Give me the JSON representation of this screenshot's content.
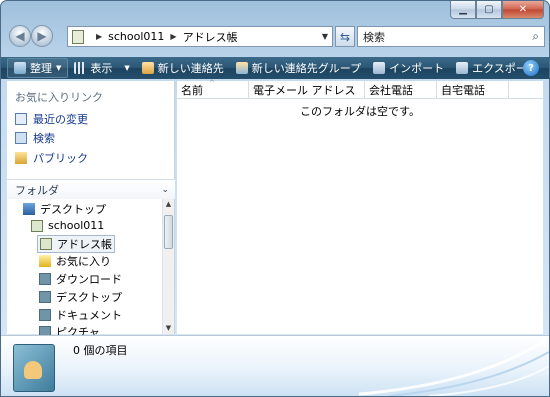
{
  "address": {
    "crumbs": [
      "school011",
      "アドレス帳"
    ]
  },
  "search": {
    "placeholder": "検索"
  },
  "toolbar": {
    "organize": "整理",
    "views": "表示",
    "new_contact": "新しい連絡先",
    "new_group": "新しい連絡先グループ",
    "import": "インポート",
    "export": "エクスポート"
  },
  "nav": {
    "favorites_title": "お気に入りリンク",
    "favorites": [
      "最近の変更",
      "検索",
      "パブリック"
    ],
    "folders_title": "フォルダ",
    "tree": [
      "デスクトップ",
      "school011",
      "アドレス帳",
      "お気に入り",
      "ダウンロード",
      "デスクトップ",
      "ドキュメント",
      "ピクチャ"
    ]
  },
  "list": {
    "columns": [
      "名前",
      "電子メール アドレス",
      "会社電話",
      "自宅電話"
    ],
    "empty_message": "このフォルダは空です。"
  },
  "details": {
    "item_count": "0 個の項目"
  },
  "colors": {
    "toolbar_bg": "#244f6d",
    "link": "#14398f",
    "close": "#c04632"
  },
  "icons": [
    "back-arrow-icon",
    "forward-arrow-icon",
    "refresh-icon",
    "search-icon",
    "help-icon"
  ]
}
